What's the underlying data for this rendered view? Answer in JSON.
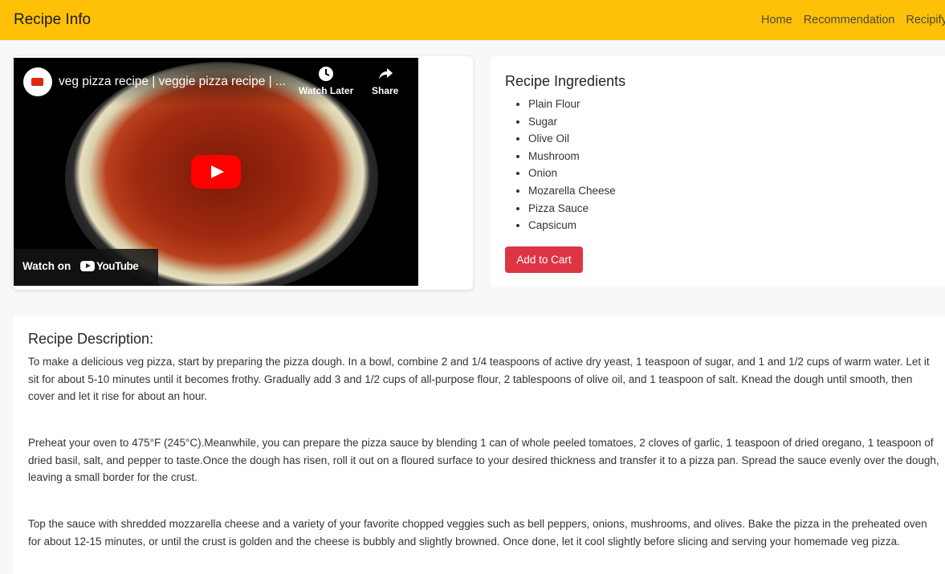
{
  "navbar": {
    "brand": "Recipe Info",
    "links": [
      "Home",
      "Recommendation",
      "Recipify"
    ],
    "bg_color": "#ffc107"
  },
  "video": {
    "title": "veg pizza recipe | veggie pizza recipe | ...",
    "watch_later": "Watch Later",
    "share": "Share",
    "watch_on": "Watch on",
    "youtube": "YouTube",
    "icons": [
      "clock-icon",
      "share-icon",
      "play-icon",
      "youtube-logo-icon"
    ]
  },
  "ingredients": {
    "title": "Recipe Ingredients",
    "items": [
      "Plain Flour",
      "Sugar",
      "Olive Oil",
      "Mushroom",
      "Onion",
      "Mozarella Cheese",
      "Pizza Sauce",
      "Capsicum"
    ],
    "add_to_cart": "Add to Cart",
    "button_color": "#dc3545"
  },
  "description": {
    "title": "Recipe Description:",
    "paragraphs": [
      "To make a delicious veg pizza, start by preparing the pizza dough. In a bowl, combine 2 and 1/4 teaspoons of active dry yeast, 1 teaspoon of sugar, and 1 and 1/2 cups of warm water. Let it sit for about 5-10 minutes until it becomes frothy. Gradually add 3 and 1/2 cups of all-purpose flour, 2 tablespoons of olive oil, and 1 teaspoon of salt. Knead the dough until smooth, then cover and let it rise for about an hour.",
      "Preheat your oven to 475°F (245°C).Meanwhile, you can prepare the pizza sauce by blending 1 can of whole peeled tomatoes, 2 cloves of garlic, 1 teaspoon of dried oregano, 1 teaspoon of dried basil, salt, and pepper to taste.Once the dough has risen, roll it out on a floured surface to your desired thickness and transfer it to a pizza pan. Spread the sauce evenly over the dough, leaving a small border for the crust.",
      "Top the sauce with shredded mozzarella cheese and a variety of your favorite chopped veggies such as bell peppers, onions, mushrooms, and olives. Bake the pizza in the preheated oven for about 12-15 minutes, or until the crust is golden and the cheese is bubbly and slightly browned. Once done, let it cool slightly before slicing and serving your homemade veg pizza."
    ]
  }
}
